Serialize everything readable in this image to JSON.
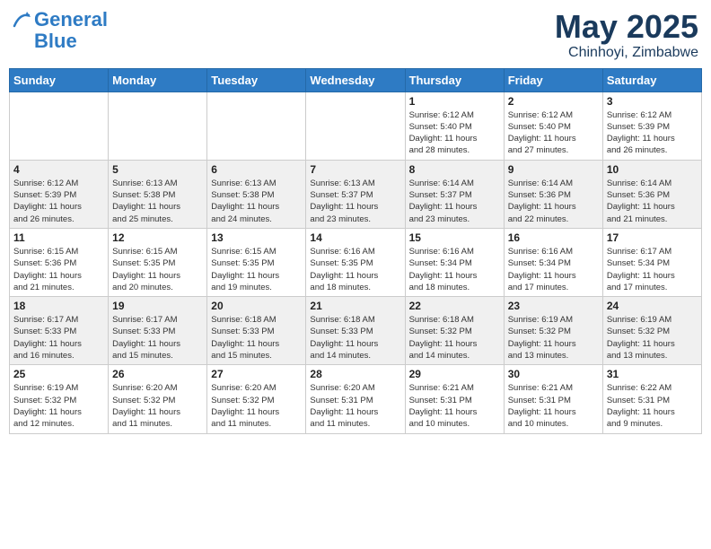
{
  "logo": {
    "line1": "General",
    "line2": "Blue"
  },
  "title": "May 2025",
  "subtitle": "Chinhoyi, Zimbabwe",
  "days_of_week": [
    "Sunday",
    "Monday",
    "Tuesday",
    "Wednesday",
    "Thursday",
    "Friday",
    "Saturday"
  ],
  "weeks": [
    [
      {
        "day": "",
        "info": ""
      },
      {
        "day": "",
        "info": ""
      },
      {
        "day": "",
        "info": ""
      },
      {
        "day": "",
        "info": ""
      },
      {
        "day": "1",
        "info": "Sunrise: 6:12 AM\nSunset: 5:40 PM\nDaylight: 11 hours\nand 28 minutes."
      },
      {
        "day": "2",
        "info": "Sunrise: 6:12 AM\nSunset: 5:40 PM\nDaylight: 11 hours\nand 27 minutes."
      },
      {
        "day": "3",
        "info": "Sunrise: 6:12 AM\nSunset: 5:39 PM\nDaylight: 11 hours\nand 26 minutes."
      }
    ],
    [
      {
        "day": "4",
        "info": "Sunrise: 6:12 AM\nSunset: 5:39 PM\nDaylight: 11 hours\nand 26 minutes."
      },
      {
        "day": "5",
        "info": "Sunrise: 6:13 AM\nSunset: 5:38 PM\nDaylight: 11 hours\nand 25 minutes."
      },
      {
        "day": "6",
        "info": "Sunrise: 6:13 AM\nSunset: 5:38 PM\nDaylight: 11 hours\nand 24 minutes."
      },
      {
        "day": "7",
        "info": "Sunrise: 6:13 AM\nSunset: 5:37 PM\nDaylight: 11 hours\nand 23 minutes."
      },
      {
        "day": "8",
        "info": "Sunrise: 6:14 AM\nSunset: 5:37 PM\nDaylight: 11 hours\nand 23 minutes."
      },
      {
        "day": "9",
        "info": "Sunrise: 6:14 AM\nSunset: 5:36 PM\nDaylight: 11 hours\nand 22 minutes."
      },
      {
        "day": "10",
        "info": "Sunrise: 6:14 AM\nSunset: 5:36 PM\nDaylight: 11 hours\nand 21 minutes."
      }
    ],
    [
      {
        "day": "11",
        "info": "Sunrise: 6:15 AM\nSunset: 5:36 PM\nDaylight: 11 hours\nand 21 minutes."
      },
      {
        "day": "12",
        "info": "Sunrise: 6:15 AM\nSunset: 5:35 PM\nDaylight: 11 hours\nand 20 minutes."
      },
      {
        "day": "13",
        "info": "Sunrise: 6:15 AM\nSunset: 5:35 PM\nDaylight: 11 hours\nand 19 minutes."
      },
      {
        "day": "14",
        "info": "Sunrise: 6:16 AM\nSunset: 5:35 PM\nDaylight: 11 hours\nand 18 minutes."
      },
      {
        "day": "15",
        "info": "Sunrise: 6:16 AM\nSunset: 5:34 PM\nDaylight: 11 hours\nand 18 minutes."
      },
      {
        "day": "16",
        "info": "Sunrise: 6:16 AM\nSunset: 5:34 PM\nDaylight: 11 hours\nand 17 minutes."
      },
      {
        "day": "17",
        "info": "Sunrise: 6:17 AM\nSunset: 5:34 PM\nDaylight: 11 hours\nand 17 minutes."
      }
    ],
    [
      {
        "day": "18",
        "info": "Sunrise: 6:17 AM\nSunset: 5:33 PM\nDaylight: 11 hours\nand 16 minutes."
      },
      {
        "day": "19",
        "info": "Sunrise: 6:17 AM\nSunset: 5:33 PM\nDaylight: 11 hours\nand 15 minutes."
      },
      {
        "day": "20",
        "info": "Sunrise: 6:18 AM\nSunset: 5:33 PM\nDaylight: 11 hours\nand 15 minutes."
      },
      {
        "day": "21",
        "info": "Sunrise: 6:18 AM\nSunset: 5:33 PM\nDaylight: 11 hours\nand 14 minutes."
      },
      {
        "day": "22",
        "info": "Sunrise: 6:18 AM\nSunset: 5:32 PM\nDaylight: 11 hours\nand 14 minutes."
      },
      {
        "day": "23",
        "info": "Sunrise: 6:19 AM\nSunset: 5:32 PM\nDaylight: 11 hours\nand 13 minutes."
      },
      {
        "day": "24",
        "info": "Sunrise: 6:19 AM\nSunset: 5:32 PM\nDaylight: 11 hours\nand 13 minutes."
      }
    ],
    [
      {
        "day": "25",
        "info": "Sunrise: 6:19 AM\nSunset: 5:32 PM\nDaylight: 11 hours\nand 12 minutes."
      },
      {
        "day": "26",
        "info": "Sunrise: 6:20 AM\nSunset: 5:32 PM\nDaylight: 11 hours\nand 11 minutes."
      },
      {
        "day": "27",
        "info": "Sunrise: 6:20 AM\nSunset: 5:32 PM\nDaylight: 11 hours\nand 11 minutes."
      },
      {
        "day": "28",
        "info": "Sunrise: 6:20 AM\nSunset: 5:31 PM\nDaylight: 11 hours\nand 11 minutes."
      },
      {
        "day": "29",
        "info": "Sunrise: 6:21 AM\nSunset: 5:31 PM\nDaylight: 11 hours\nand 10 minutes."
      },
      {
        "day": "30",
        "info": "Sunrise: 6:21 AM\nSunset: 5:31 PM\nDaylight: 11 hours\nand 10 minutes."
      },
      {
        "day": "31",
        "info": "Sunrise: 6:22 AM\nSunset: 5:31 PM\nDaylight: 11 hours\nand 9 minutes."
      }
    ]
  ]
}
